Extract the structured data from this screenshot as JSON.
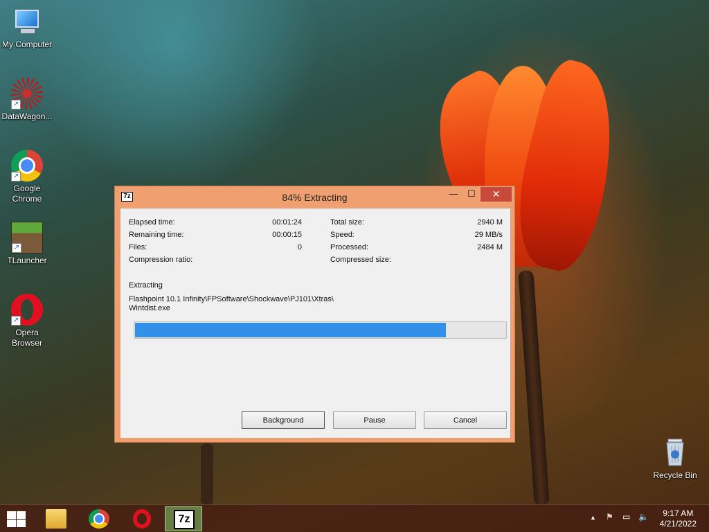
{
  "desktop": {
    "icons": [
      {
        "label": "My Computer"
      },
      {
        "label": "DataWagon..."
      },
      {
        "label": "Google Chrome"
      },
      {
        "label": "TLauncher"
      },
      {
        "label": "Opera Browser"
      },
      {
        "label": "Recycle Bin"
      }
    ]
  },
  "dialog": {
    "app_icon_text": "7z",
    "title": "84% Extracting",
    "minimize_glyph": "—",
    "maximize_glyph": "☐",
    "close_glyph": "✕",
    "stats_left": [
      {
        "label": "Elapsed time:",
        "value": "00:01:24"
      },
      {
        "label": "Remaining time:",
        "value": "00:00:15"
      },
      {
        "label": "Files:",
        "value": "0"
      },
      {
        "label": "Compression ratio:",
        "value": ""
      }
    ],
    "stats_right": [
      {
        "label": "Total size:",
        "value": "2940 M"
      },
      {
        "label": "Speed:",
        "value": "29 MB/s"
      },
      {
        "label": "Processed:",
        "value": "2484 M"
      },
      {
        "label": "Compressed size:",
        "value": ""
      }
    ],
    "operation_label": "Extracting",
    "current_path": "Flashpoint 10.1 Infinity\\FPSoftware\\Shockwave\\PJ101\\Xtras\\",
    "current_file": "Wintdist.exe",
    "progress_percent": 84,
    "buttons": {
      "background": "Background",
      "pause": "Pause",
      "cancel": "Cancel"
    }
  },
  "taskbar": {
    "active_app_label": "7z",
    "tray": {
      "up_arrow": "▲",
      "flag": "⚑",
      "network": "▭",
      "volume": "🔈"
    },
    "time": "9:17 AM",
    "date": "4/21/2022"
  },
  "colors": {
    "window_frame": "#f0a070",
    "close_button": "#c74a3c",
    "progress_fill": "#3390e8"
  }
}
